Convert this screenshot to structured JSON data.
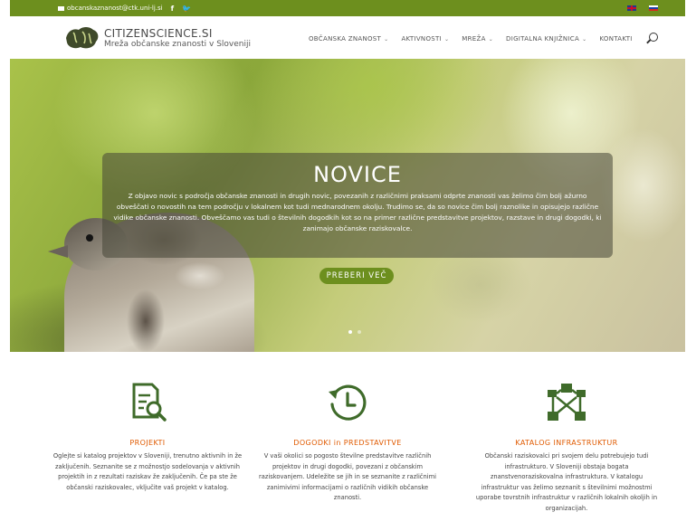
{
  "topbar": {
    "email": "obcanskaznanost@ctk.uni-lj.si",
    "social": [
      {
        "icon": "facebook-icon",
        "glyph": "f"
      },
      {
        "icon": "twitter-icon",
        "glyph": "🐦"
      }
    ],
    "languages": [
      "English",
      "Slovenščina"
    ]
  },
  "header": {
    "logo_icon": "citizenscience-logo-icon",
    "title": "CITIZENSCIENCE.SI",
    "subtitle": "Mreža občanske znanosti v Sloveniji"
  },
  "nav": {
    "items": [
      {
        "label": "OBČANSKA ZNANOST",
        "dropdown": true
      },
      {
        "label": "AKTIVNOSTI",
        "dropdown": true
      },
      {
        "label": "MREŽA",
        "dropdown": true
      },
      {
        "label": "DIGITALNA KNJIŽNICA",
        "dropdown": true
      },
      {
        "label": "KONTAKTI",
        "dropdown": false
      }
    ],
    "search_icon": "search-icon"
  },
  "hero": {
    "title": "NOVICE",
    "text": "Z objavo novic s področja občanske znanosti in drugih novic, povezanih z različnimi praksami odprte znanosti vas želimo čim bolj ažurno obveščati o novostih na tem področju v lokalnem kot tudi mednarodnem okolju. Trudimo se, da so novice čim bolj raznolike in opisujejo različne vidike občanske znanosti. Obveščamo vas tudi o številnih dogodkih kot so na primer različne predstavitve projektov, razstave in drugi dogodki, ki zanimajo občanske raziskovalce.",
    "button": "PREBERI VEČ",
    "slides": 2,
    "active_slide": 1
  },
  "features": [
    {
      "icon": "catalog-search-icon",
      "title": "PROJEKTI",
      "text": "Oglejte si katalog projektov v Sloveniji, trenutno aktivnih in že zaključenih. Seznanite se z možnostjo sodelovanja v aktivnih projektih in z rezultati raziskav že zaključenih. Če pa ste že občanski raziskovalec, vključite vaš projekt v katalog."
    },
    {
      "icon": "history-clock-icon",
      "title": "DOGODKI in PREDSTAVITVE",
      "text": "V vaši okolici so pogosto številne predstavitve različnih projektov in drugi dogodki, povezani z občanskim raziskovanjem. Udeležite se jih in se seznanite z različnimi zanimivimi informacijami o različnih vidikih občanske znanosti."
    },
    {
      "icon": "network-nodes-icon",
      "title": "KATALOG INFRASTRUKTUR",
      "text": "Občanski raziskovalci pri svojem delu potrebujejo tudi infrastrukturo. V Sloveniji obstaja bogata znanstvenoraziskovalna infrastruktura. V katalogu infrastruktur vas želimo seznanit s številnimi možnostmi uporabe tovrstnih infrastruktur v različnih lokalnih okoljih in organizacijah."
    }
  ],
  "colors": {
    "brand_green": "#6d8f1e",
    "accent_orange": "#e05a00",
    "icon_green": "#3f6b2a"
  }
}
